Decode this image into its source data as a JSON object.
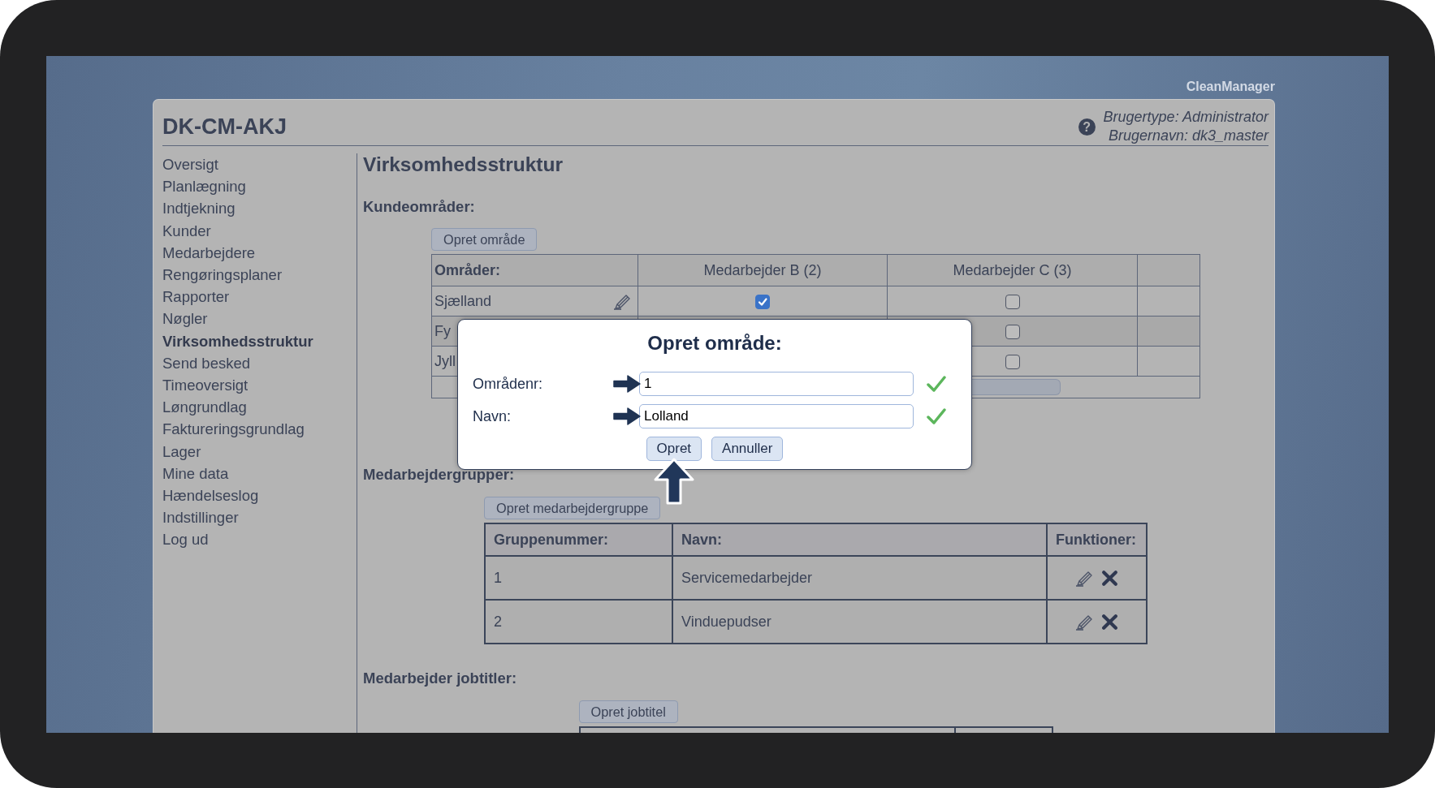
{
  "screen": {
    "brand": "CleanManager"
  },
  "header": {
    "title": "DK-CM-AKJ",
    "help_icon": "?",
    "user_type": "Brugertype: Administrator",
    "user_name": "Brugernavn: dk3_master"
  },
  "sidebar": {
    "items": [
      {
        "label": "Oversigt",
        "selected": false
      },
      {
        "label": "Planlægning",
        "selected": false
      },
      {
        "label": "Indtjekning",
        "selected": false
      },
      {
        "label": "Kunder",
        "selected": false
      },
      {
        "label": "Medarbejdere",
        "selected": false
      },
      {
        "label": "Rengøringsplaner",
        "selected": false
      },
      {
        "label": "Rapporter",
        "selected": false
      },
      {
        "label": "Nøgler",
        "selected": false
      },
      {
        "label": "Virksomhedsstruktur",
        "selected": true
      },
      {
        "label": "Send besked",
        "selected": false
      },
      {
        "label": "Timeoversigt",
        "selected": false
      },
      {
        "label": "Løngrundlag",
        "selected": false
      },
      {
        "label": "Faktureringsgrundlag",
        "selected": false
      },
      {
        "label": "Lager",
        "selected": false
      },
      {
        "label": "Mine data",
        "selected": false
      },
      {
        "label": "Hændelseslog",
        "selected": false
      },
      {
        "label": "Indstillinger",
        "selected": false
      },
      {
        "label": "Log ud",
        "selected": false
      }
    ]
  },
  "page_title": "Virksomhedsstruktur",
  "customer_areas": {
    "heading": "Kundeområder:",
    "button": "Opret område",
    "columns": [
      "Områder:",
      "Medarbejder B (2)",
      "Medarbejder C (3)"
    ],
    "rows": [
      {
        "label": "Sjælland",
        "editable": true,
        "medarbejder_b": {
          "checked": true
        },
        "medarbejder_c": {
          "checked": false
        }
      },
      {
        "label": "Fy",
        "medarbejder_c": {
          "checked": false
        }
      },
      {
        "label": "Jyll",
        "medarbejder_c": {
          "checked": false
        }
      }
    ]
  },
  "employee_groups": {
    "heading": "Medarbejdergrupper:",
    "button": "Opret medarbejdergruppe",
    "columns": [
      "Gruppenummer:",
      "Navn:",
      "Funktioner:"
    ],
    "rows": [
      {
        "number": "1",
        "name": "Servicemedarbejder"
      },
      {
        "number": "2",
        "name": "Vinduepudser"
      }
    ]
  },
  "job_titles": {
    "heading": "Medarbejder jobtitler:",
    "button": "Opret jobtitel"
  },
  "dialog": {
    "title": "Opret område:",
    "fields": [
      {
        "label": "Områdenr:",
        "value": "1",
        "valid": true,
        "pointer_arrow": true
      },
      {
        "label": "Navn:",
        "value": "Lolland",
        "valid": true,
        "pointer_arrow": true
      }
    ],
    "buttons": [
      {
        "label": "Opret",
        "pointer_arrow": true
      },
      {
        "label": "Annuller",
        "pointer_arrow": false
      }
    ]
  }
}
